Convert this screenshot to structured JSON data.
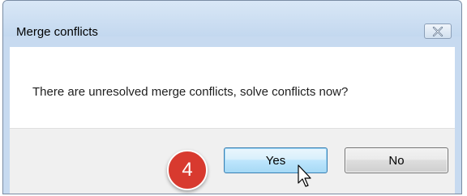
{
  "dialog": {
    "title": "Merge conflicts",
    "message": "There are unresolved merge conflicts, solve conflicts now?",
    "close_icon": "close-icon",
    "buttons": {
      "yes_label": "Yes",
      "no_label": "No"
    }
  },
  "annotation": {
    "step_number": "4",
    "color": "#d83a2f"
  },
  "cursor": {
    "icon": "pointer-cursor-icon"
  }
}
